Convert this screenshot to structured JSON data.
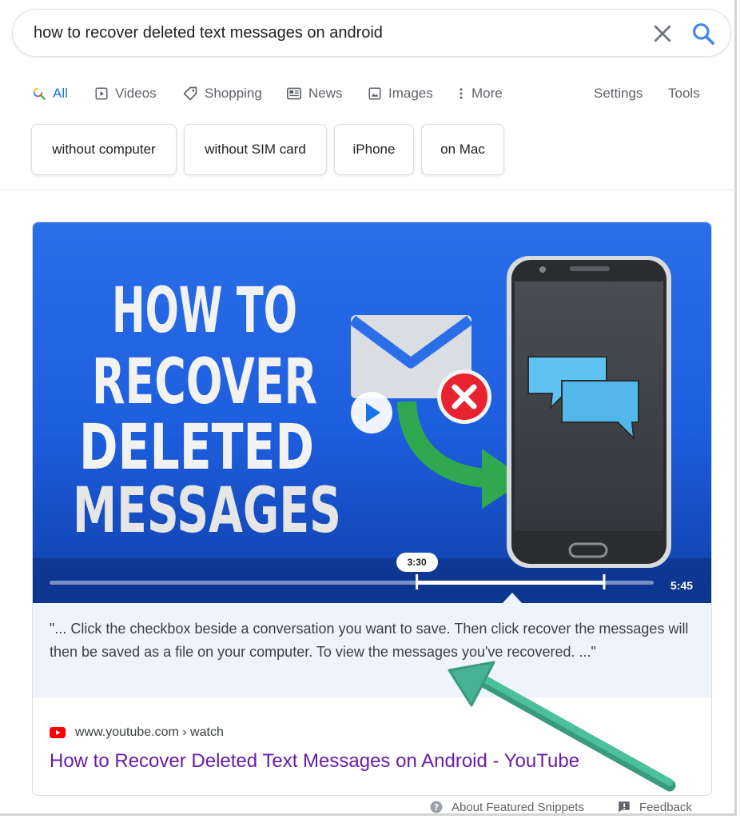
{
  "search": {
    "query": "how to recover deleted text messages on android"
  },
  "tabs": [
    {
      "label": "All",
      "icon": "search-icon"
    },
    {
      "label": "Videos",
      "icon": "play-box-icon"
    },
    {
      "label": "Shopping",
      "icon": "tag-icon"
    },
    {
      "label": "News",
      "icon": "newspaper-icon"
    },
    {
      "label": "Images",
      "icon": "image-icon"
    },
    {
      "label": "More",
      "icon": "more-vert-icon"
    }
  ],
  "tools": {
    "settings": "Settings",
    "tools": "Tools"
  },
  "chips": [
    "without computer",
    "without SIM card",
    "iPhone",
    "on Mac"
  ],
  "video": {
    "thumbnail_lines": [
      "HOW TO",
      "RECOVER",
      "DELETED",
      "MESSAGES"
    ],
    "current_time": "3:30",
    "duration": "5:45",
    "clip_start_fraction": 0.608,
    "clip_end_fraction": 0.918
  },
  "snippet": {
    "text": "\"... Click the checkbox beside a conversation you want to save. Then click recover the messages will then be saved as a file on your computer. To view the messages you've recovered. ...\""
  },
  "result": {
    "source_url": "www.youtube.com › watch",
    "title": "How to Recover Deleted Text Messages on Android - YouTube"
  },
  "footer": {
    "about": "About Featured Snippets",
    "feedback": "Feedback"
  },
  "colors": {
    "accent": "#1a73e8",
    "visited_link": "#681da8",
    "thumbnail_blue": "#1d5ede",
    "annotation_arrow": "#45b295",
    "youtube_red": "#ff0000"
  }
}
